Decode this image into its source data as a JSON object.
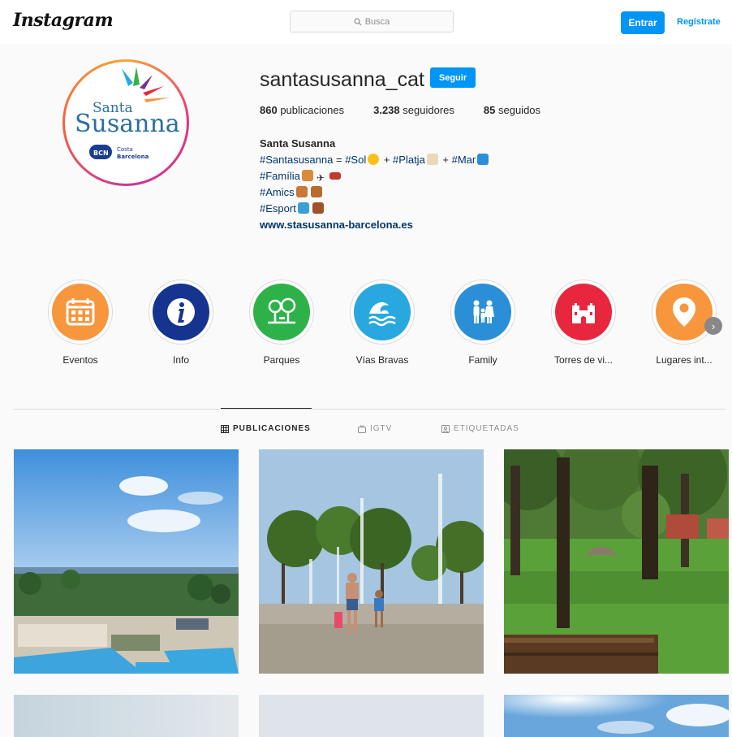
{
  "topbar": {
    "logo": "Instagram",
    "search_placeholder": "Busca",
    "login_label": "Entrar",
    "signup_label": "Regístrate"
  },
  "profile": {
    "username": "santasusanna_cat",
    "follow_label": "Seguir",
    "stats": [
      {
        "count": "860",
        "label": "publicaciones"
      },
      {
        "count": "3.238",
        "label": "seguidores"
      },
      {
        "count": "85",
        "label": "seguidos"
      }
    ],
    "avatar_logo": {
      "line1": "Santa",
      "line2": "Susanna",
      "badge": "BCN",
      "sub1": "Costa",
      "sub2": "Barcelona"
    },
    "bio": {
      "name": "Santa Susanna",
      "line1_a": "#Santasusanna",
      "line1_b": " = ",
      "line1_c": "#Sol",
      "line1_d": " + ",
      "line1_e": "#Platja",
      "line1_f": " + ",
      "line1_g": "#Mar",
      "line2": "#Família",
      "line3": "#Amics",
      "line4": "#Esport",
      "website": "www.stasusanna-barcelona.es"
    }
  },
  "highlights": [
    {
      "label": "Eventos",
      "color": "#f7963d",
      "icon": "calendar-icon"
    },
    {
      "label": "Info",
      "color": "#15338f",
      "icon": "info-icon"
    },
    {
      "label": "Parques",
      "color": "#2db24a",
      "icon": "tree-icon"
    },
    {
      "label": "Vías Bravas",
      "color": "#29a8e0",
      "icon": "wave-icon"
    },
    {
      "label": "Family",
      "color": "#2a8fd6",
      "icon": "family-icon"
    },
    {
      "label": "Torres de vi...",
      "color": "#e8263d",
      "icon": "castle-icon"
    },
    {
      "label": "Lugares int...",
      "color": "#f7963d",
      "icon": "location-pin-icon"
    }
  ],
  "tabs": [
    {
      "label": "PUBLICACIONES",
      "icon": "grid-icon",
      "active": true
    },
    {
      "label": "IGTV",
      "icon": "igtv-icon",
      "active": false
    },
    {
      "label": "ETIQUETADAS",
      "icon": "tagged-icon",
      "active": false
    }
  ],
  "posts": [
    {
      "subject": "hotel-pool-photo"
    },
    {
      "subject": "fountain-photo"
    },
    {
      "subject": "park-photo"
    },
    {
      "subject": "beach-photo"
    },
    {
      "subject": "sky-photo"
    },
    {
      "subject": "sun-clouds-photo"
    }
  ]
}
